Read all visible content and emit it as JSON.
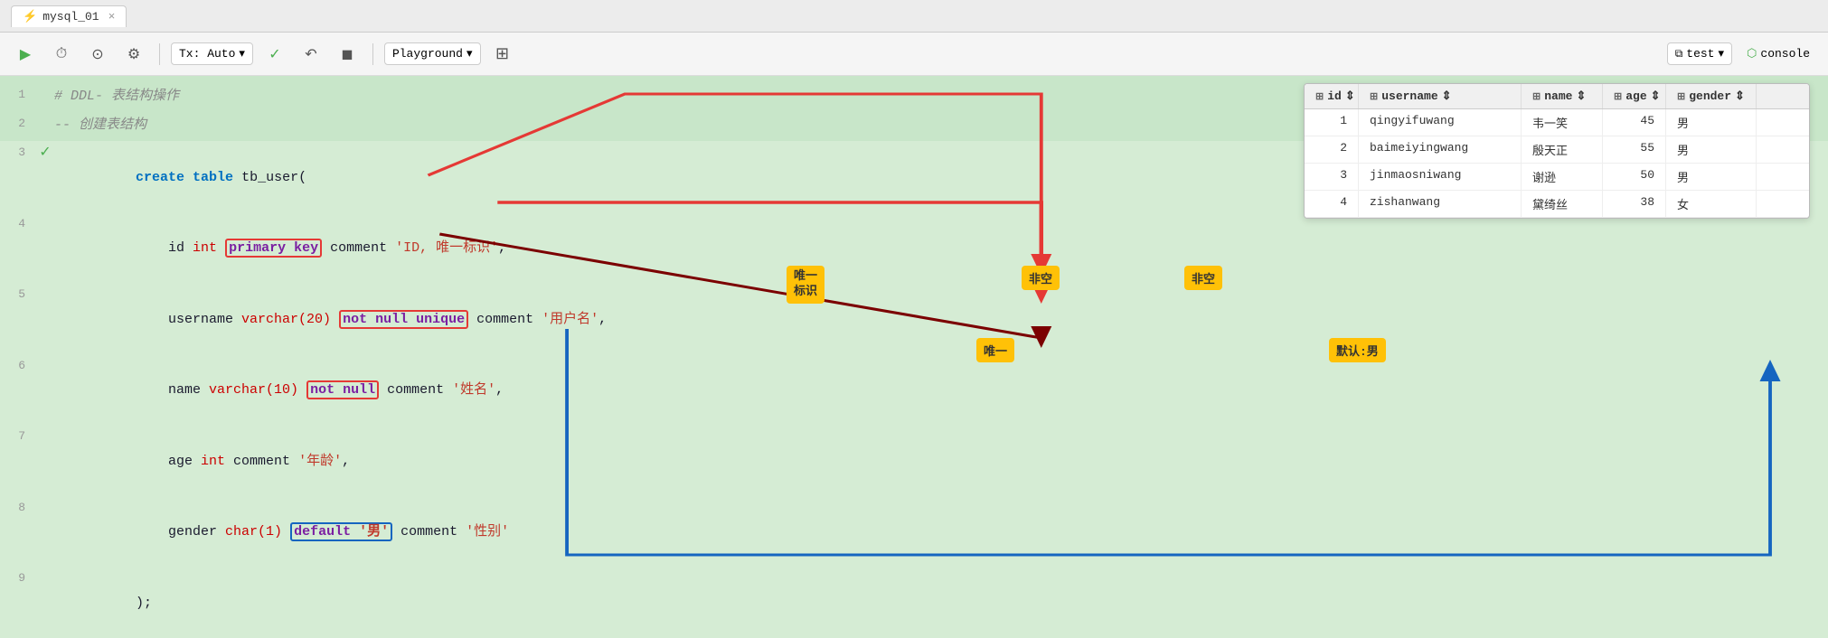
{
  "tab": {
    "name": "mysql_01",
    "close_label": "×"
  },
  "toolbar": {
    "play_label": "▶",
    "history_label": "⏱",
    "pin_label": "⊙",
    "settings_label": "⚙",
    "tx_label": "Tx: Auto",
    "check_label": "✓",
    "undo_label": "↶",
    "stop_label": "◼",
    "playground_label": "Playground",
    "grid_label": "⊞",
    "test_label": "test",
    "console_label": "console"
  },
  "code": {
    "lines": [
      {
        "num": "1",
        "indicator": "",
        "text": "# DDL- 表结构操作",
        "class": "c-comment"
      },
      {
        "num": "2",
        "indicator": "",
        "text": "-- 创建表结构",
        "class": "c-comment"
      },
      {
        "num": "3",
        "indicator": "✓",
        "text": "create table tb_user(",
        "class": "c-plain"
      },
      {
        "num": "4",
        "indicator": "",
        "text": "    id int ",
        "class": "c-plain"
      },
      {
        "num": "5",
        "indicator": "",
        "text": "    username varchar(20) ",
        "class": "c-plain"
      },
      {
        "num": "6",
        "indicator": "",
        "text": "    name varchar(10) ",
        "class": "c-plain"
      },
      {
        "num": "7",
        "indicator": "",
        "text": "    age int comment '年龄',",
        "class": "c-plain"
      },
      {
        "num": "8",
        "indicator": "",
        "text": "    gender char(1) ",
        "class": "c-plain"
      },
      {
        "num": "9",
        "indicator": "",
        "text": ");",
        "class": "c-plain"
      }
    ]
  },
  "table": {
    "headers": [
      "id",
      "username",
      "name",
      "age",
      "gender"
    ],
    "rows": [
      {
        "id": "1",
        "username": "qingyifuwang",
        "name": "韦一笑",
        "age": "45",
        "gender": "男"
      },
      {
        "id": "2",
        "username": "baimeiyingwang",
        "name": "殷天正",
        "age": "55",
        "gender": "男"
      },
      {
        "id": "3",
        "username": "jinmaosniwang",
        "name": "谢逊",
        "age": "50",
        "gender": "男"
      },
      {
        "id": "4",
        "username": "zishanwang",
        "name": "黛绮丝",
        "age": "38",
        "gender": "女"
      }
    ]
  },
  "labels": {
    "unique_id": "唯一\n标识",
    "not_null1": "非空",
    "not_null2": "非空",
    "unique1": "唯一",
    "default_male": "默认:男"
  },
  "highlights": {
    "primary_key": "primary key",
    "not_null_unique": "not null unique",
    "not_null": "not null",
    "default_male": "default '男'"
  }
}
